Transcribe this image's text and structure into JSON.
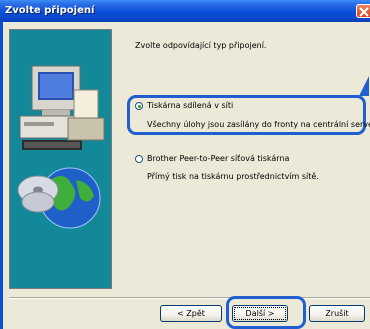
{
  "window": {
    "title": "Zvolte připojení",
    "close_icon": "close-icon",
    "title_bar_color": "#0a4fd8"
  },
  "prompt": "Zvolte odpovídající typ připojení.",
  "options": [
    {
      "label": "Tiskárna sdílená v síti",
      "description": "Všechny úlohy jsou zasílány do fronty na centrální server.",
      "selected": true
    },
    {
      "label": "Brother Peer-to-Peer síťová tiskárna",
      "description": "Přímý tisk na tiskárnu prostřednictvím sítě.",
      "selected": false
    }
  ],
  "buttons": {
    "back": "< Zpět",
    "next": "Další >",
    "cancel": "Zrušit"
  },
  "highlight_color": "#1f5fcf"
}
